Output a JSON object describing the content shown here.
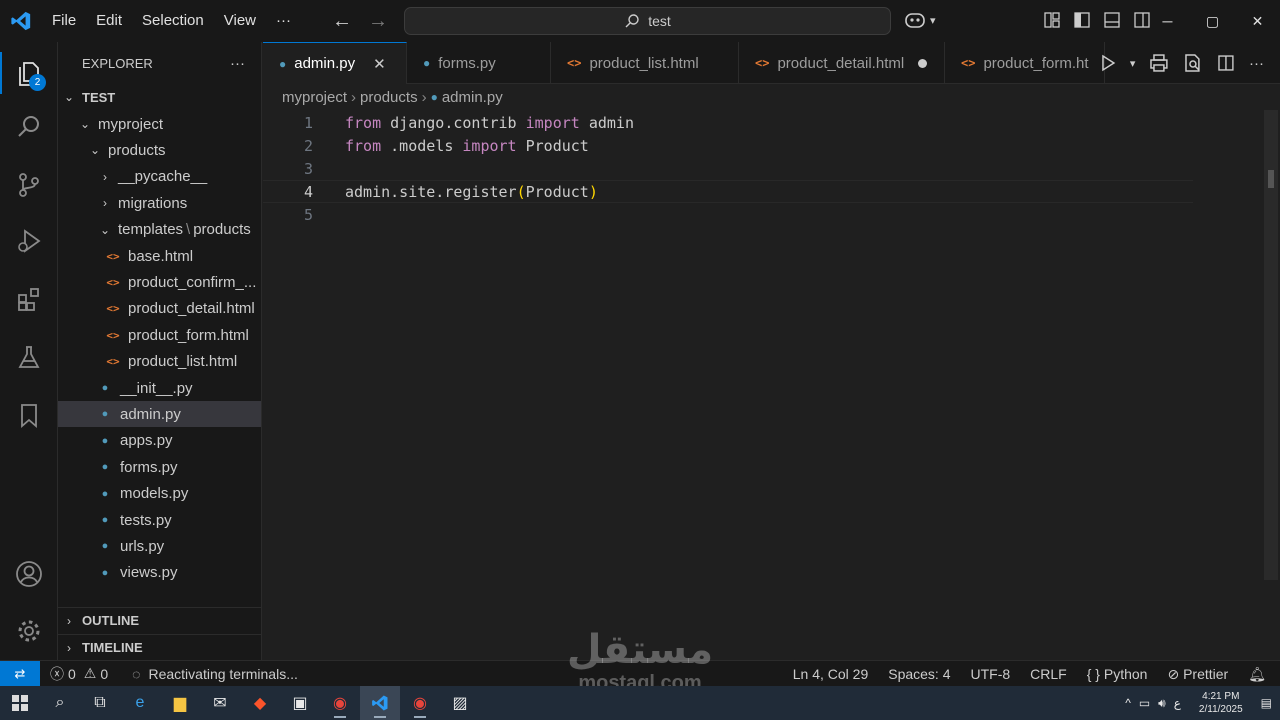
{
  "titlebar": {
    "menu": [
      "File",
      "Edit",
      "Selection",
      "View"
    ],
    "more": "···",
    "search_text": "test"
  },
  "activity": {
    "explorer_badge": "2"
  },
  "sidebar": {
    "title": "EXPLORER",
    "more": "···",
    "root": "TEST",
    "tree": [
      {
        "label": "myproject",
        "level": 1,
        "kind": "folder-open"
      },
      {
        "label": "products",
        "level": 2,
        "kind": "folder-open"
      },
      {
        "label": "__pycache__",
        "level": 3,
        "kind": "folder-closed"
      },
      {
        "label": "migrations",
        "level": 3,
        "kind": "folder-closed"
      },
      {
        "label": "templates",
        "label2": "products",
        "level": 3,
        "kind": "folder-open"
      },
      {
        "label": "base.html",
        "level": 4,
        "kind": "html"
      },
      {
        "label": "product_confirm_...",
        "level": 4,
        "kind": "html"
      },
      {
        "label": "product_detail.html",
        "level": 4,
        "kind": "html"
      },
      {
        "label": "product_form.html",
        "level": 4,
        "kind": "html"
      },
      {
        "label": "product_list.html",
        "level": 4,
        "kind": "html"
      },
      {
        "label": "__init__.py",
        "level": 3,
        "kind": "py"
      },
      {
        "label": "admin.py",
        "level": 3,
        "kind": "py",
        "selected": true
      },
      {
        "label": "apps.py",
        "level": 3,
        "kind": "py"
      },
      {
        "label": "forms.py",
        "level": 3,
        "kind": "py"
      },
      {
        "label": "models.py",
        "level": 3,
        "kind": "py"
      },
      {
        "label": "tests.py",
        "level": 3,
        "kind": "py"
      },
      {
        "label": "urls.py",
        "level": 3,
        "kind": "py"
      },
      {
        "label": "views.py",
        "level": 3,
        "kind": "py"
      }
    ],
    "outline": "OUTLINE",
    "timeline": "TIMELINE"
  },
  "tabs": [
    {
      "label": "admin.py",
      "kind": "py",
      "active": true
    },
    {
      "label": "forms.py",
      "kind": "py"
    },
    {
      "label": "product_list.html",
      "kind": "html"
    },
    {
      "label": "product_detail.html",
      "kind": "html",
      "modified": true
    },
    {
      "label": "product_form.ht",
      "kind": "html"
    }
  ],
  "breadcrumb": [
    "myproject",
    "products",
    "admin.py"
  ],
  "editor": {
    "line_numbers": [
      "1",
      "2",
      "3",
      "4",
      "5"
    ],
    "current_line": 4,
    "lines": [
      [
        {
          "t": "from",
          "c": "kw"
        },
        {
          "t": " django.contrib "
        },
        {
          "t": "import",
          "c": "kw"
        },
        {
          "t": " admin"
        }
      ],
      [
        {
          "t": "from",
          "c": "kw"
        },
        {
          "t": " .models "
        },
        {
          "t": "import",
          "c": "kw"
        },
        {
          "t": " Product"
        }
      ],
      [],
      [
        {
          "t": "admin.site.register"
        },
        {
          "t": "(",
          "c": "br"
        },
        {
          "t": "Product"
        },
        {
          "t": ")",
          "c": "br"
        }
      ],
      []
    ]
  },
  "status": {
    "errors": "0",
    "warnings": "0",
    "message": "Reactivating terminals...",
    "position": "Ln 4, Col 29",
    "spaces": "Spaces: 4",
    "encoding": "UTF-8",
    "eol": "CRLF",
    "language": "Python",
    "formatter": "Prettier"
  },
  "watermark": {
    "arabic": "مستقل",
    "latin": "mostaql.com"
  },
  "taskbar": {
    "time": "4:21 PM",
    "date": "2/11/2025",
    "lang": "ع"
  }
}
